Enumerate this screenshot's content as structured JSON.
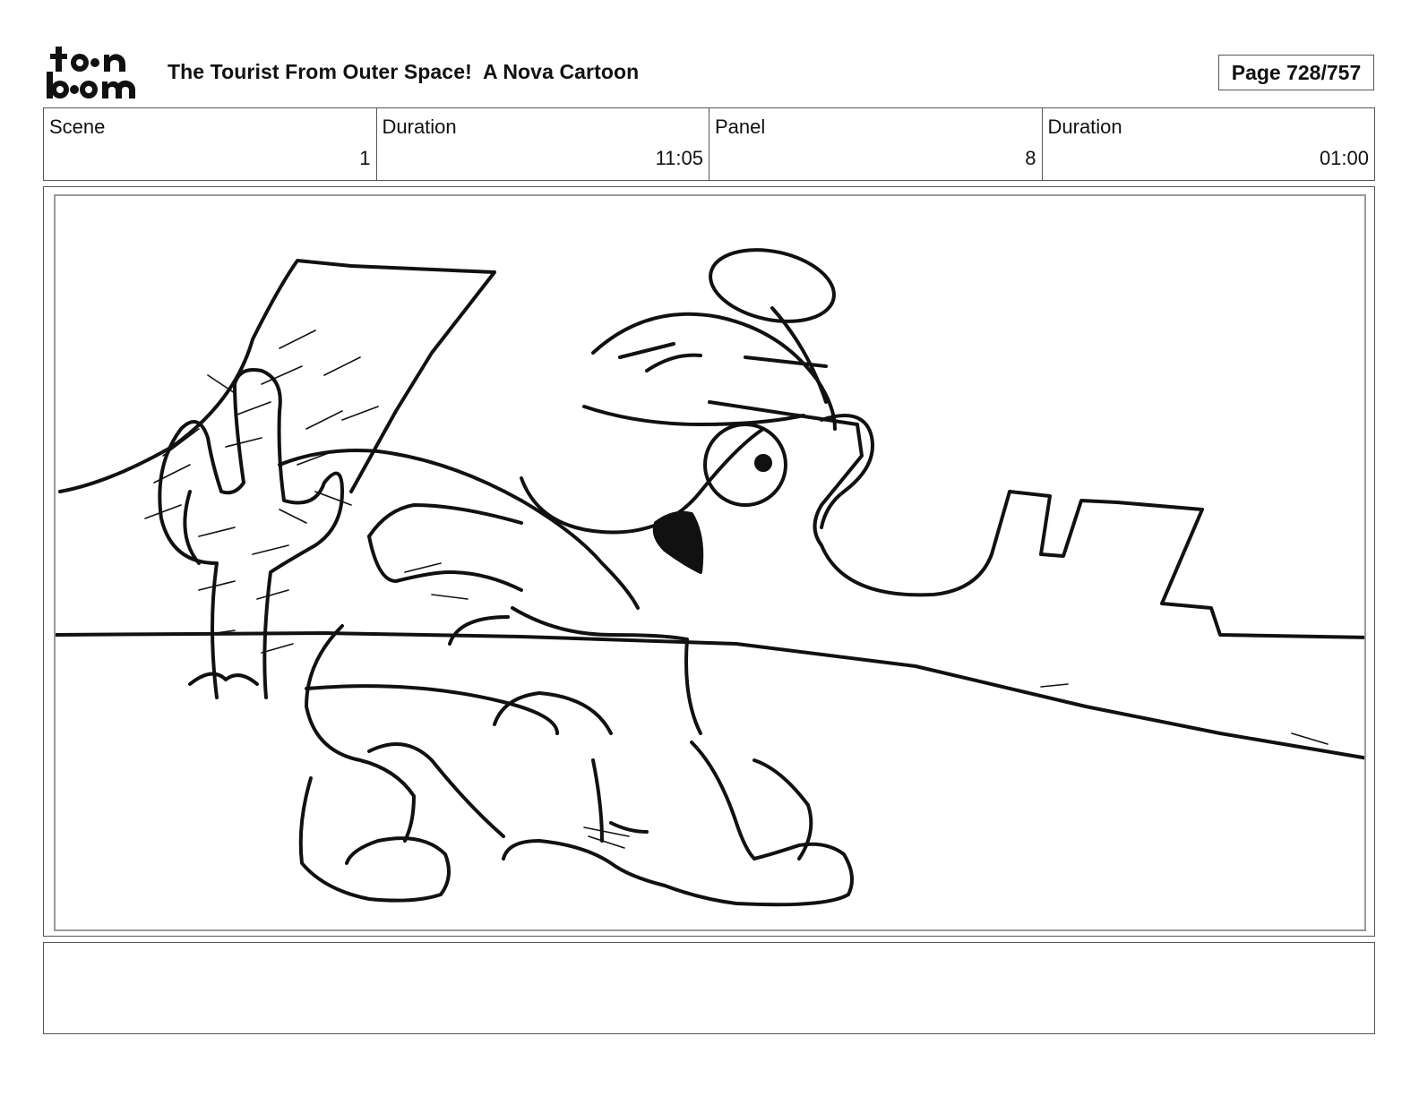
{
  "header": {
    "logo_text": "toon boom",
    "title": "The Tourist From Outer Space!  A Nova Cartoon",
    "page": "Page 728/757"
  },
  "info": [
    {
      "label": "Scene",
      "value": "1"
    },
    {
      "label": "Duration",
      "value": "11:05"
    },
    {
      "label": "Panel",
      "value": "8"
    },
    {
      "label": "Duration",
      "value": "01:00"
    }
  ],
  "notes": ""
}
